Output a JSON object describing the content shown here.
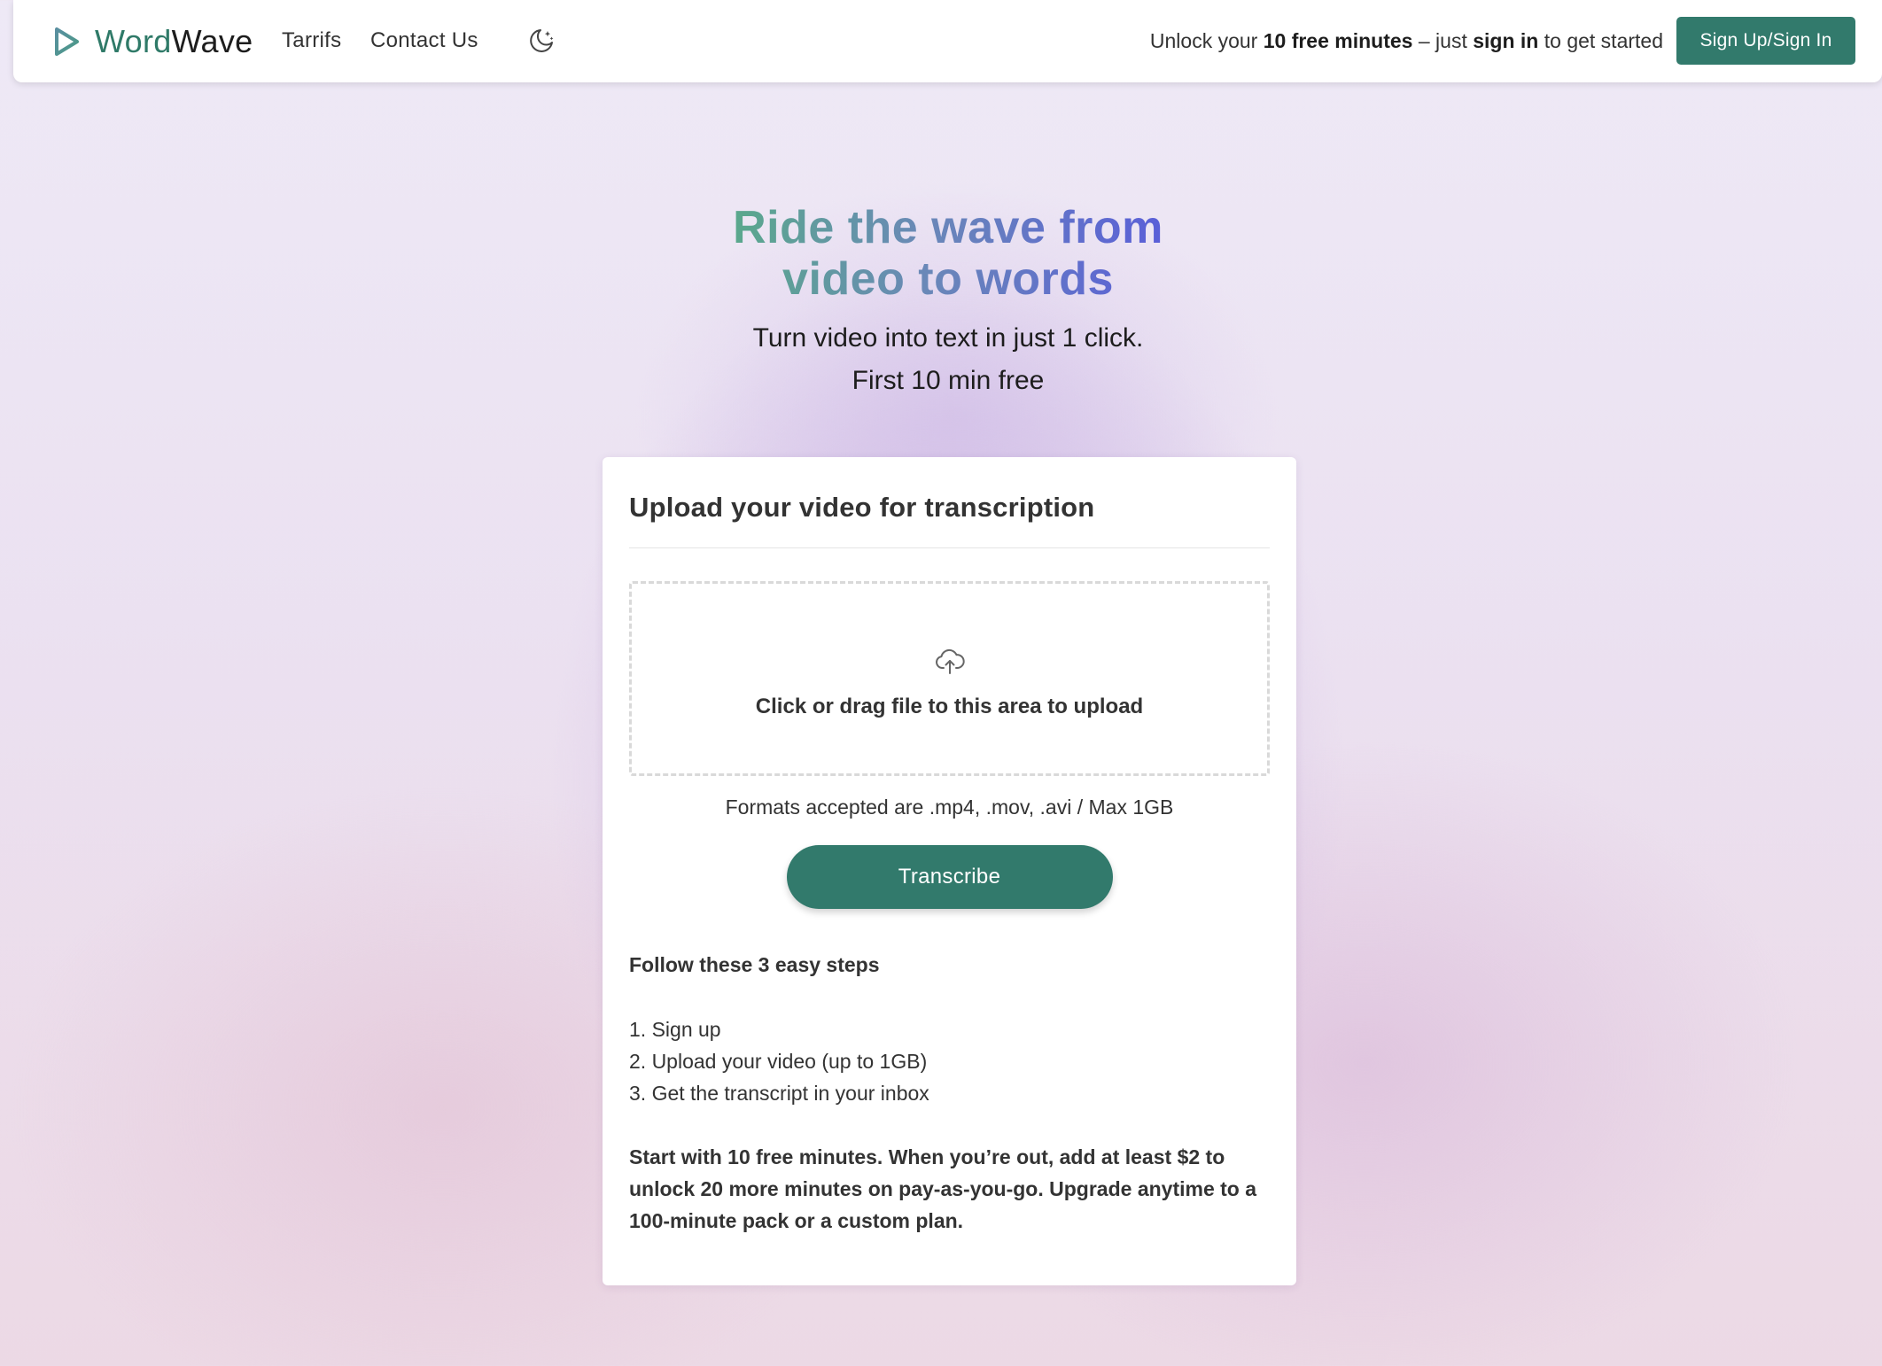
{
  "nav": {
    "brand_part1": "Word",
    "brand_part2": "Wave",
    "links": [
      {
        "label": "Tarrifs"
      },
      {
        "label": "Contact Us"
      }
    ],
    "promo": {
      "prefix": "Unlock your ",
      "highlight1": "10 free minutes",
      "middle": " – just ",
      "highlight2": "sign in",
      "suffix": " to get started"
    },
    "signin_label": "Sign Up/Sign In",
    "theme_icon": "moon-stars-icon"
  },
  "hero": {
    "title_line1": "Ride the wave from",
    "title_line2": "video to words",
    "subtitle_line1": "Turn video into text in just 1 click.",
    "subtitle_line2": "First 10 min free"
  },
  "card": {
    "title": "Upload your video for transcription",
    "dropzone_icon": "cloud-upload-icon",
    "dropzone_text": "Click or drag file to this area to upload",
    "formats": "Formats accepted are .mp4, .mov, .avi / Max 1GB",
    "transcribe_label": "Transcribe",
    "steps_title": "Follow these 3 easy steps",
    "steps": [
      "1. Sign up",
      "2. Upload your video (up to 1GB)",
      "3. Get the transcript in your inbox"
    ],
    "pricing_note": "Start with 10 free minutes. When you’re out, add at least $2 to unlock 20 more minutes on pay-as-you-go. Upgrade anytime to a 100-minute pack or a custom plan."
  },
  "colors": {
    "brand_green": "#327a6c",
    "title_gradient_start": "#5aa88c",
    "title_gradient_end": "#5a5fd8"
  }
}
